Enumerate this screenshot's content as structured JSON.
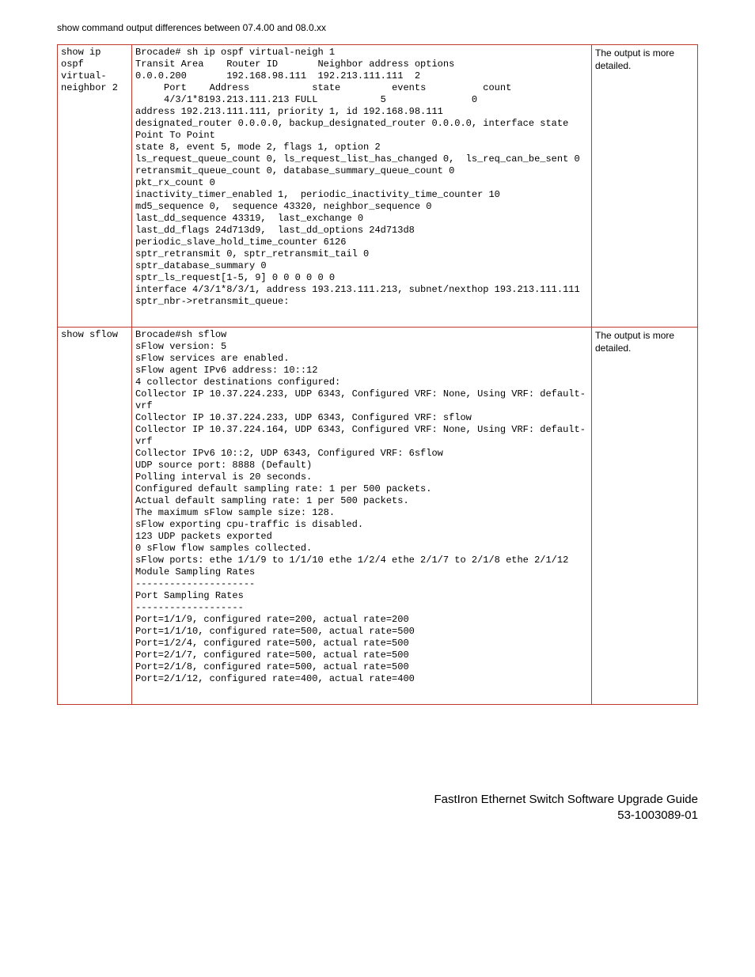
{
  "heading": "show command output differences between 07.4.00 and 08.0.xx",
  "rows": [
    {
      "cmd": "show ip ospf virtual-neighbor 2",
      "output": "Brocade# sh ip ospf virtual-neigh 1\nTransit Area    Router ID       Neighbor address options\n0.0.0.200       192.168.98.111  192.213.111.111  2\n     Port    Address           state         events          count\n     4/3/1*8193.213.111.213 FULL           5               0\naddress 192.213.111.111, priority 1, id 192.168.98.111\ndesignated_router 0.0.0.0, backup_designated_router 0.0.0.0, interface state Point To Point\nstate 8, event 5, mode 2, flags 1, option 2\nls_request_queue_count 0, ls_request_list_has_changed 0,  ls_req_can_be_sent 0\nretransmit_queue_count 0, database_summary_queue_count 0\npkt_rx_count 0\ninactivity_timer_enabled 1,  periodic_inactivity_time_counter 10\nmd5_sequence 0,  sequence 43320, neighbor_sequence 0\nlast_dd_sequence 43319,  last_exchange 0\nlast_dd_flags 24d713d9,  last_dd_options 24d713d8\nperiodic_slave_hold_time_counter 6126\nsptr_retransmit 0, sptr_retransmit_tail 0\nsptr_database_summary 0\nsptr_ls_request[1-5, 9] 0 0 0 0 0 0\ninterface 4/3/1*8/3/1, address 193.213.111.213, subnet/nexthop 193.213.111.111\nsptr_nbr->retransmit_queue:",
      "note": "The output is more detailed."
    },
    {
      "cmd": "show sflow",
      "output": "Brocade#sh sflow\nsFlow version: 5\nsFlow services are enabled.\nsFlow agent IPv6 address: 10::12\n4 collector destinations configured:\nCollector IP 10.37.224.233, UDP 6343, Configured VRF: None, Using VRF: default-vrf\nCollector IP 10.37.224.233, UDP 6343, Configured VRF: sflow\nCollector IP 10.37.224.164, UDP 6343, Configured VRF: None, Using VRF: default-vrf\nCollector IPv6 10::2, UDP 6343, Configured VRF: 6sflow\nUDP source port: 8888 (Default)\nPolling interval is 20 seconds.\nConfigured default sampling rate: 1 per 500 packets.\nActual default sampling rate: 1 per 500 packets.\nThe maximum sFlow sample size: 128.\nsFlow exporting cpu-traffic is disabled.\n123 UDP packets exported\n0 sFlow flow samples collected.\nsFlow ports: ethe 1/1/9 to 1/1/10 ethe 1/2/4 ethe 2/1/7 to 2/1/8 ethe 2/1/12\nModule Sampling Rates\n---------------------\nPort Sampling Rates\n-------------------\nPort=1/1/9, configured rate=200, actual rate=200\nPort=1/1/10, configured rate=500, actual rate=500\nPort=1/2/4, configured rate=500, actual rate=500\nPort=2/1/7, configured rate=500, actual rate=500\nPort=2/1/8, configured rate=500, actual rate=500\nPort=2/1/12, configured rate=400, actual rate=400",
      "note": "The output is more detailed."
    }
  ],
  "footer": {
    "title": "FastIron Ethernet Switch Software Upgrade Guide",
    "partno": "53-1003089-01"
  }
}
